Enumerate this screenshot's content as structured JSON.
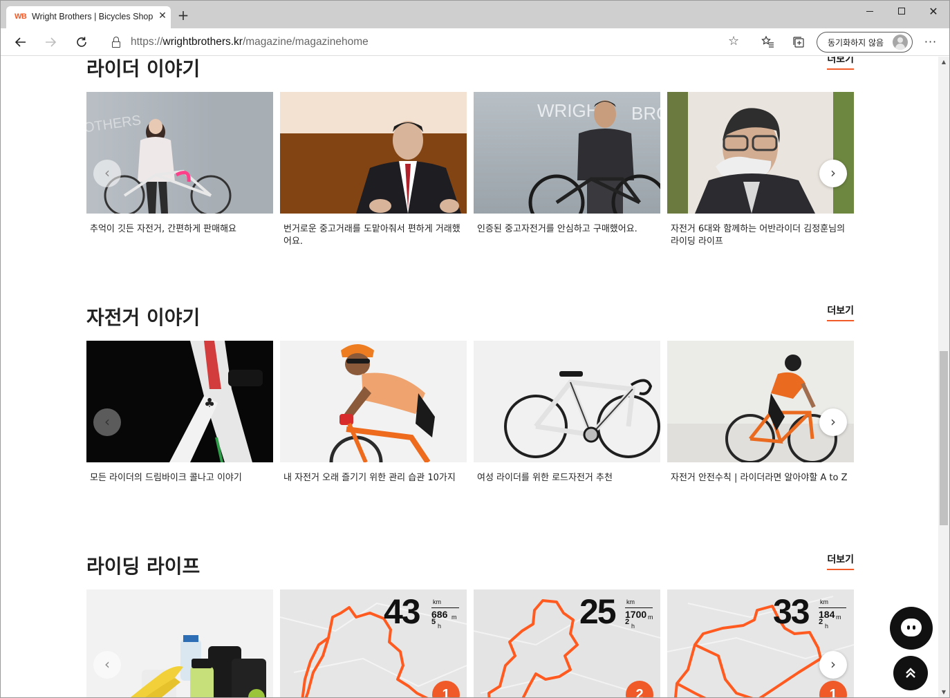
{
  "browser": {
    "tab_title": "Wright Brothers | Bicycles Shopping",
    "tab_favicon": "WB",
    "url_scheme": "https://",
    "url_host": "wrightbrothers.kr",
    "url_path": "/magazine/magazinehome",
    "profile_label": "동기화하지 않음"
  },
  "sections": {
    "rider": {
      "title": "라이더 이야기",
      "more": "더보기",
      "cards": [
        {
          "title": "추억이 깃든 자전거, 간편하게 판매해요"
        },
        {
          "title": "번거로운 중고거래를 도맡아줘서 편하게 거래했어요."
        },
        {
          "title": "인증된 중고자전거를 안심하고 구매했어요."
        },
        {
          "title": "자전거 6대와 함께하는 어반라이더 김정훈님의 라이딩 라이프"
        }
      ]
    },
    "bicycle": {
      "title": "자전거 이야기",
      "more": "더보기",
      "cards": [
        {
          "title": "모든 라이더의 드림바이크 콜나고 이야기"
        },
        {
          "title": "내 자전거 오래 즐기기 위한 관리 습관 10가지"
        },
        {
          "title": "여성 라이더를 위한 로드자전거 추천"
        },
        {
          "title": "자전거 안전수칙 | 라이더라면 알아야할 A to Z"
        }
      ]
    },
    "riding": {
      "title": "라이딩 라이프",
      "more": "더보기",
      "maps": [
        {
          "distance": "43",
          "unit": "km",
          "elevation": "686",
          "elevation_unit": "m",
          "hours": "5",
          "hours_unit": "h",
          "badge": "1"
        },
        {
          "distance": "25",
          "unit": "km",
          "elevation": "1700",
          "elevation_unit": "m",
          "hours": "2",
          "hours_unit": "h",
          "badge": "2"
        },
        {
          "distance": "33",
          "unit": "km",
          "elevation": "184",
          "elevation_unit": "m",
          "hours": "2",
          "hours_unit": "h",
          "badge": "1"
        }
      ]
    }
  },
  "colors": {
    "accent": "#f05a28",
    "route": "#ff5a1f",
    "dark": "#111111"
  },
  "icons": {
    "back": "arrow-left-icon",
    "forward": "arrow-right-icon",
    "reload": "reload-icon",
    "lock": "lock-icon",
    "star": "star-icon",
    "favorites": "favorites-icon",
    "collections": "collections-icon",
    "more": "more-icon",
    "chat": "chat-icon",
    "top": "chevron-double-up-icon"
  }
}
